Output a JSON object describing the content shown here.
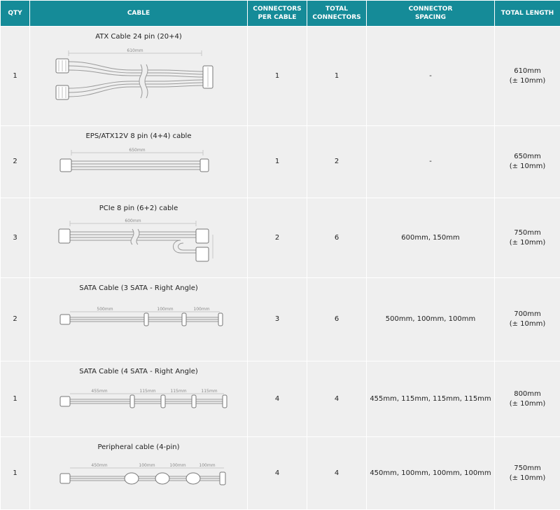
{
  "headers": {
    "qty": "QTY",
    "cable": "CABLE",
    "connectors_per_cable": [
      "CONNECTORS",
      "PER CABLE"
    ],
    "total_connectors": [
      "TOTAL",
      "CONNECTORS"
    ],
    "connector_spacing": [
      "CONNECTOR",
      "SPACING"
    ],
    "total_length": "TOTAL LENGTH"
  },
  "rows": [
    {
      "qty": "1",
      "cable": "ATX Cable 24 pin (20+4)",
      "diagram_icon": "atx-24pin-cable-icon",
      "dimension": "610mm",
      "connectors_per_cable": "1",
      "total_connectors": "1",
      "connector_spacing": "-",
      "length": "610mm",
      "tolerance": "(± 10mm)"
    },
    {
      "qty": "2",
      "cable": "EPS/ATX12V 8 pin (4+4) cable",
      "diagram_icon": "eps-8pin-cable-icon",
      "dimension": "650mm",
      "connectors_per_cable": "1",
      "total_connectors": "2",
      "connector_spacing": "-",
      "length": "650mm",
      "tolerance": "(± 10mm)"
    },
    {
      "qty": "3",
      "cable": "PCIe 8 pin (6+2) cable",
      "diagram_icon": "pcie-8pin-cable-icon",
      "dimension": "600mm",
      "connectors_per_cable": "2",
      "total_connectors": "6",
      "connector_spacing": "600mm, 150mm",
      "length": "750mm",
      "tolerance": "(± 10mm)"
    },
    {
      "qty": "2",
      "cable": "SATA Cable (3 SATA - Right Angle)",
      "diagram_icon": "sata-3-cable-icon",
      "dimension_labels": [
        "500mm",
        "100mm",
        "100mm"
      ],
      "connectors_per_cable": "3",
      "total_connectors": "6",
      "connector_spacing": "500mm, 100mm, 100mm",
      "length": "700mm",
      "tolerance": "(± 10mm)"
    },
    {
      "qty": "1",
      "cable": "SATA Cable (4 SATA - Right Angle)",
      "diagram_icon": "sata-4-cable-icon",
      "dimension_labels": [
        "455mm",
        "115mm",
        "115mm",
        "115mm"
      ],
      "connectors_per_cable": "4",
      "total_connectors": "4",
      "connector_spacing": "455mm, 115mm, 115mm, 115mm",
      "length": "800mm",
      "tolerance": "(± 10mm)"
    },
    {
      "qty": "1",
      "cable": "Peripheral cable (4-pin)",
      "diagram_icon": "peripheral-4pin-cable-icon",
      "dimension_labels": [
        "450mm",
        "100mm",
        "100mm",
        "100mm"
      ],
      "connectors_per_cable": "4",
      "total_connectors": "4",
      "connector_spacing": "450mm, 100mm, 100mm, 100mm",
      "length": "750mm",
      "tolerance": "(± 10mm)"
    }
  ],
  "colors": {
    "header_bg": "#158b98",
    "header_text": "#ffffff",
    "row_bg": "#efefef",
    "line": "#aaaaaa"
  }
}
